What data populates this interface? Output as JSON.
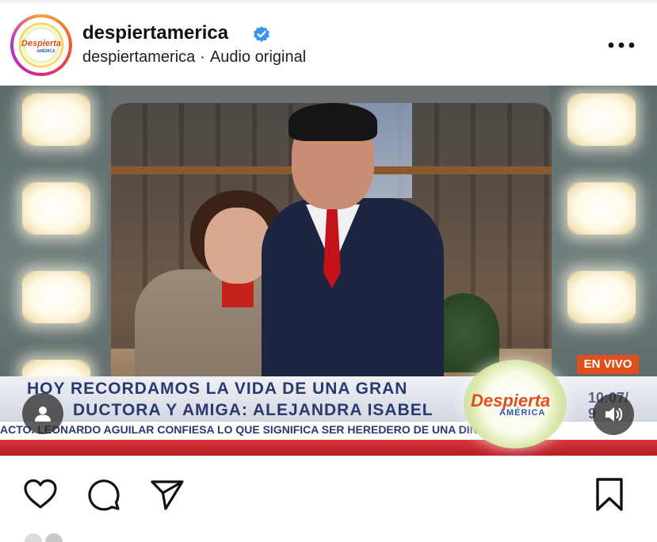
{
  "post": {
    "username": "despiertamerica",
    "subtitle_username": "despiertamerica",
    "subtitle_separator": "·",
    "audio_label": "Audio original",
    "avatar_logo_text_1": "Despierta",
    "avatar_logo_text_2": "AMÉRICA"
  },
  "video": {
    "live_badge": "EN VIVO",
    "headline_line1": "HOY RECORDAMOS LA VIDA DE UNA GRAN",
    "headline_line2": "DUCTORA Y AMIGA: ALEJANDRA ISABEL",
    "ticker": "ACTO. LEONARDO AGUILAR CONFIESA LO QUE SIGNIFICA SER HEREDERO DE UNA DINA",
    "show_logo_name": "Despierta",
    "show_logo_sub": "AMÉRICA",
    "time_line1": "10:07/",
    "time_line2": "9"
  },
  "icons": {
    "verified": "verified-badge-icon",
    "more": "more-horizontal-icon",
    "user_tag": "user-tag-icon",
    "sound": "sound-on-icon",
    "like": "heart-icon",
    "comment": "comment-icon",
    "share": "send-icon",
    "save": "bookmark-icon"
  },
  "colors": {
    "verified_blue": "#3797f0",
    "live_orange": "#e0501e",
    "headline_navy": "#2b3a6e",
    "ticker_red": "#c4262d"
  }
}
